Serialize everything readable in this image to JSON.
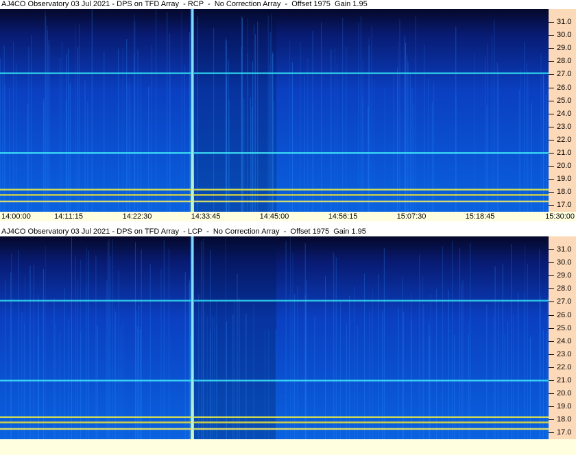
{
  "panels": [
    {
      "id": "rcp",
      "title": "AJ4CO Observatory 03 Jul 2021 - DPS on TFD Array  - RCP  -  No Correction Array  -  Offset 1975  Gain 1.95"
    },
    {
      "id": "lcp",
      "title": "AJ4CO Observatory 03 Jul 2021 - DPS on TFD Array  - LCP  -  No Correction Array  -  Offset 1975  Gain 1.95"
    }
  ],
  "time_labels": [
    "14:00:00",
    "14:11:15",
    "14:22:30",
    "14:33:45",
    "14:45:00",
    "14:56:15",
    "15:07:30",
    "15:18:45",
    "15:30:00"
  ],
  "freq_labels": [
    "31.0",
    "30.0",
    "29.0",
    "28.0",
    "27.0",
    "26.0",
    "25.0",
    "24.0",
    "23.0",
    "22.0",
    "21.0",
    "20.0",
    "19.0",
    "18.0",
    "17.0"
  ],
  "chart_data": [
    {
      "type": "heatmap",
      "title": "AJ4CO Observatory 03 Jul 2021 - DPS on TFD Array  - RCP  -  No Correction Array  -  Offset 1975  Gain 1.95",
      "x_ticks": [
        "14:00:00",
        "14:11:15",
        "14:22:30",
        "14:33:45",
        "14:45:00",
        "14:56:15",
        "15:07:30",
        "15:18:45",
        "15:30:00"
      ],
      "y_ticks": [
        31.0,
        30.0,
        29.0,
        28.0,
        27.0,
        26.0,
        25.0,
        24.0,
        23.0,
        22.0,
        21.0,
        20.0,
        19.0,
        18.0,
        17.0
      ],
      "ylim": [
        16.5,
        32.0
      ],
      "xlim": [
        "14:00:00",
        "15:30:00"
      ],
      "features": {
        "broadband_burst_time": "14:31:30",
        "horizontal_lines_freq": [
          27.1,
          21.0,
          18.2,
          17.8,
          17.3
        ]
      }
    },
    {
      "type": "heatmap",
      "title": "AJ4CO Observatory 03 Jul 2021 - DPS on TFD Array  - LCP  -  No Correction Array  -  Offset 1975  Gain 1.95",
      "x_ticks": [],
      "y_ticks": [
        31.0,
        30.0,
        29.0,
        28.0,
        27.0,
        26.0,
        25.0,
        24.0,
        23.0,
        22.0,
        21.0,
        20.0,
        19.0,
        18.0,
        17.0
      ],
      "ylim": [
        16.5,
        32.0
      ],
      "xlim": [
        "14:00:00",
        "15:30:00"
      ],
      "features": {
        "broadband_burst_time": "14:31:30",
        "horizontal_lines_freq": [
          27.1,
          21.0,
          18.2,
          17.8,
          17.3
        ]
      }
    }
  ],
  "colors": {
    "background_dark": "#05082a",
    "background_mid": "#0a3fc0",
    "background_low": "#0a62e0",
    "line_cyan": "#3fe0f0",
    "line_yellow": "#f0f040",
    "axis_strip": "#fcd9b8",
    "time_strip": "#ffffe0"
  }
}
